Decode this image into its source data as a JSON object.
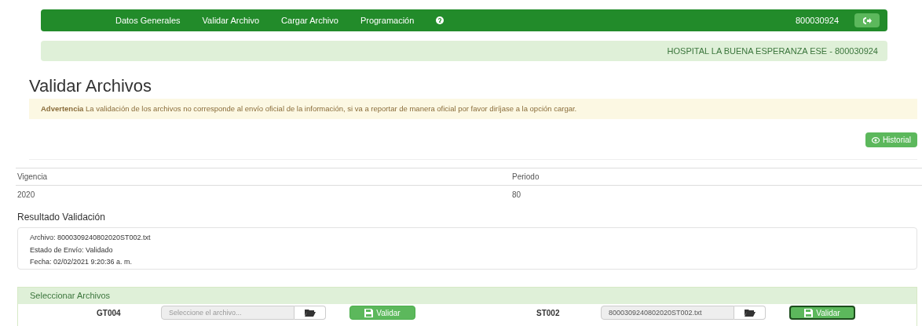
{
  "navbar": {
    "items": [
      "Datos Generales",
      "Validar Archivo",
      "Cargar Archivo",
      "Programación"
    ],
    "user": "800030924"
  },
  "entity_banner": "HOSPITAL LA BUENA ESPERANZA ESE - 800030924",
  "title": "Validar Archivos",
  "warning": "**Advertencia** La validación de los archivos no corresponde al envío oficial de la información, si va a reportar de manera oficial por favor diríjase a la opción cargar.",
  "history_button": "Historial",
  "table": {
    "columns": [
      "Vigencia",
      "Periodo"
    ],
    "rows": [
      [
        "2020",
        "80"
      ]
    ]
  },
  "result": {
    "heading": "Resultado Validación",
    "lines": [
      "Archivo: 8000309240802020ST002.txt",
      "Estado de Envío: Validado",
      "Fecha: 02/02/2021 9:20:36 a. m."
    ]
  },
  "files_panel": {
    "title": "Seleccionar Archivos",
    "files": [
      {
        "code": "GT004",
        "placeholder": "Seleccione el archivo...",
        "button": "Validar",
        "focused": false
      },
      {
        "code": "ST002",
        "value": "8000309240802020ST002.txt",
        "button": "Validar",
        "focused": true
      }
    ]
  }
}
